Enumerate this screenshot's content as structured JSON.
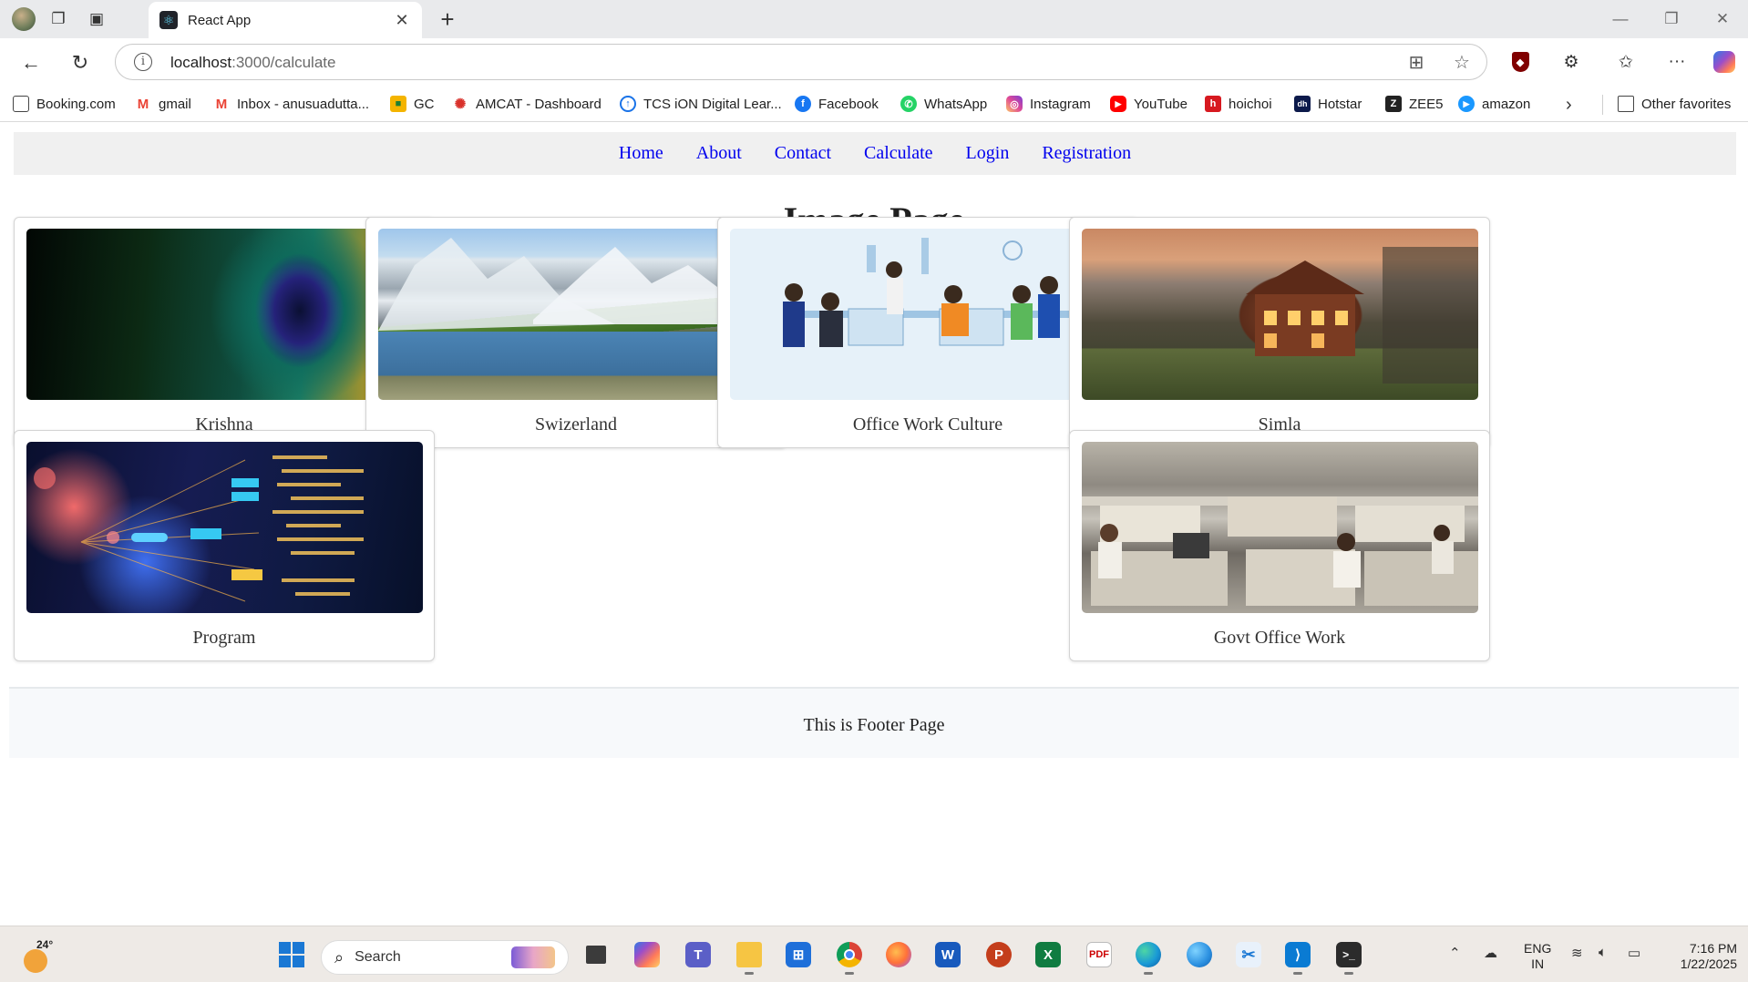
{
  "browser": {
    "tab_title": "React App",
    "address": {
      "host": "localhost",
      "path": ":3000/calculate"
    },
    "bookmarks": [
      {
        "label": "Booking.com",
        "icon": "page-icon",
        "color": "#444444"
      },
      {
        "label": "gmail",
        "icon": "gmail-icon",
        "color": "#ea4335"
      },
      {
        "label": "Inbox - anusuadutta...",
        "icon": "gmail-icon",
        "color": "#ea4335"
      },
      {
        "label": "GC",
        "icon": "classroom-icon",
        "color": "#f4b400"
      },
      {
        "label": "AMCAT - Dashboard",
        "icon": "amcat-icon",
        "color": "#d9312b"
      },
      {
        "label": "TCS iON Digital Lear...",
        "icon": "tcs-icon",
        "color": "#1a73e8"
      },
      {
        "label": "Facebook",
        "icon": "facebook-icon",
        "color": "#1877f2"
      },
      {
        "label": "WhatsApp",
        "icon": "whatsapp-icon",
        "color": "#25d366"
      },
      {
        "label": "Instagram",
        "icon": "instagram-icon",
        "color": "#d6249f"
      },
      {
        "label": "YouTube",
        "icon": "youtube-icon",
        "color": "#ff0000"
      },
      {
        "label": "hoichoi",
        "icon": "hoichoi-icon",
        "color": "#d71920"
      },
      {
        "label": "Hotstar",
        "icon": "hotstar-icon",
        "color": "#0c1a4b"
      },
      {
        "label": "ZEE5",
        "icon": "zee5-icon",
        "color": "#222222"
      },
      {
        "label": "amazon",
        "icon": "prime-video-icon",
        "color": "#1a98ff"
      }
    ],
    "other_favorites": "Other favorites"
  },
  "nav": {
    "links": [
      "Home",
      "About",
      "Contact",
      "Calculate",
      "Login",
      "Registration"
    ],
    "link_color": "#0000ee"
  },
  "page": {
    "title": "Image Page",
    "cards": [
      {
        "caption": "Krishna"
      },
      {
        "caption": "Swizerland"
      },
      {
        "caption": "Office Work Culture"
      },
      {
        "caption": "Simla"
      },
      {
        "caption": "Program"
      },
      {
        "caption": "Govt Office Work"
      }
    ]
  },
  "footer": {
    "text": "This is Footer Page"
  },
  "taskbar": {
    "weather_temp": "24°",
    "search_label": "Search",
    "lang_top": "ENG",
    "lang_bottom": "IN",
    "time": "7:16 PM",
    "date": "1/22/2025"
  }
}
